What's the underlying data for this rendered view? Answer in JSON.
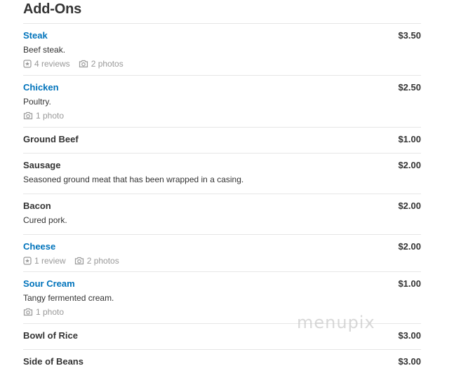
{
  "section": {
    "title": "Add-Ons"
  },
  "items": [
    {
      "name": "Steak",
      "price": "$3.50",
      "description": "Beef steak.",
      "reviews": "4 reviews",
      "photos": "2 photos"
    },
    {
      "name": "Chicken",
      "price": "$2.50",
      "description": "Poultry.",
      "photos": "1 photo"
    },
    {
      "name": "Ground Beef",
      "price": "$1.00"
    },
    {
      "name": "Sausage",
      "price": "$2.00",
      "description": "Seasoned ground meat that has been wrapped in a casing."
    },
    {
      "name": "Bacon",
      "price": "$2.00",
      "description": "Cured pork."
    },
    {
      "name": "Cheese",
      "price": "$2.00",
      "reviews": "1 review",
      "photos": "2 photos"
    },
    {
      "name": "Sour Cream",
      "price": "$1.00",
      "description": "Tangy fermented cream.",
      "photos": "1 photo"
    },
    {
      "name": "Bowl of Rice",
      "price": "$3.00"
    },
    {
      "name": "Side of Beans",
      "price": "$3.00"
    }
  ],
  "icons": {
    "review": "review-star-icon",
    "photo": "camera-icon"
  },
  "colors": {
    "link": "#0073bb",
    "text": "#333333",
    "muted": "#999999",
    "divider": "#e6e6e6"
  },
  "watermark": "menupix"
}
